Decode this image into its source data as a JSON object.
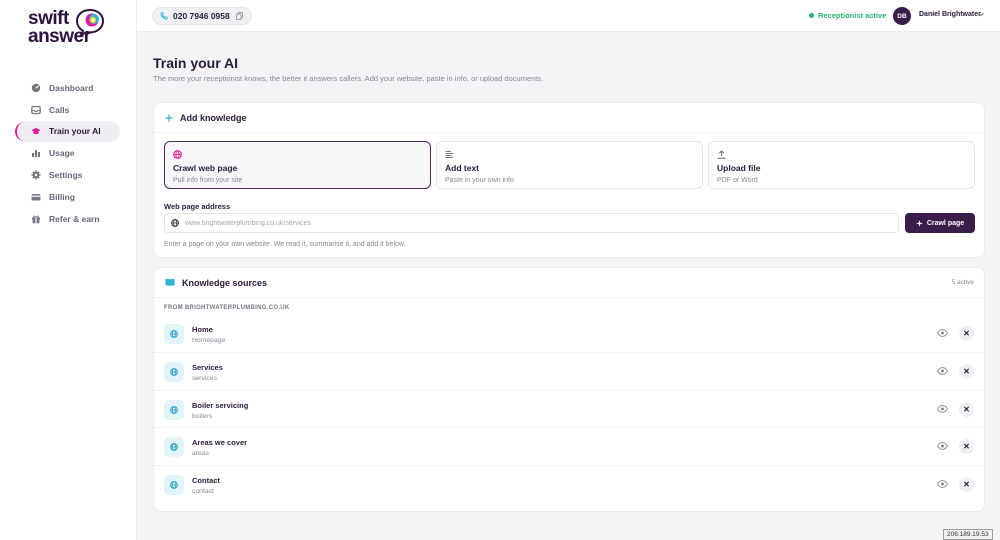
{
  "brand": {
    "line1": "swift",
    "line2": "answer"
  },
  "sidebar": {
    "items": [
      {
        "label": "Dashboard",
        "icon": "dashboard-icon"
      },
      {
        "label": "Calls",
        "icon": "inbox-icon"
      },
      {
        "label": "Train your AI",
        "icon": "graduation-cap-icon",
        "active": true
      },
      {
        "label": "Usage",
        "icon": "bar-chart-icon"
      },
      {
        "label": "Settings",
        "icon": "gear-icon"
      },
      {
        "label": "Billing",
        "icon": "credit-card-icon"
      },
      {
        "label": "Refer & earn",
        "icon": "gift-icon"
      }
    ]
  },
  "topbar": {
    "phone": "020 7946 0958",
    "status": "Receptionist active",
    "avatar_initials": "DB",
    "user_name": "Daniel Brightwater"
  },
  "page": {
    "title": "Train your AI",
    "subtitle": "The more your receptionist knows, the better it answers callers. Add your website, paste in info, or upload documents."
  },
  "add_knowledge": {
    "title": "Add knowledge",
    "options": [
      {
        "title": "Crawl web page",
        "desc": "Pull info from your site",
        "icon": "globe-icon",
        "selected": true
      },
      {
        "title": "Add text",
        "desc": "Paste in your own info",
        "icon": "text-lines-icon"
      },
      {
        "title": "Upload file",
        "desc": "PDF or Word",
        "icon": "upload-icon"
      }
    ],
    "address_label": "Web page address",
    "address_placeholder": "www.brightwaterplumbing.co.uk/services",
    "address_value": "",
    "button": "Crawl page",
    "help": "Enter a page on your own website. We read it, summarise it, and add it below."
  },
  "knowledge_sources": {
    "title": "Knowledge sources",
    "count": "5 active",
    "group_label": "FROM BRIGHTWATERPLUMBING.CO.UK",
    "items": [
      {
        "title": "Home",
        "path": "Homepage"
      },
      {
        "title": "Services",
        "path": "services"
      },
      {
        "title": "Boiler servicing",
        "path": "boilers"
      },
      {
        "title": "Areas we cover",
        "path": "areas"
      },
      {
        "title": "Contact",
        "path": "contact"
      }
    ],
    "remove_glyph": "✕"
  },
  "ip_badge": "206.189.19.53",
  "colors": {
    "brand_dark": "#3a1d48",
    "accent_pink": "#e6189b",
    "status_green": "#22b573",
    "source_icon_bg": "#e0f4f9",
    "source_icon": "#2a9fc0"
  }
}
